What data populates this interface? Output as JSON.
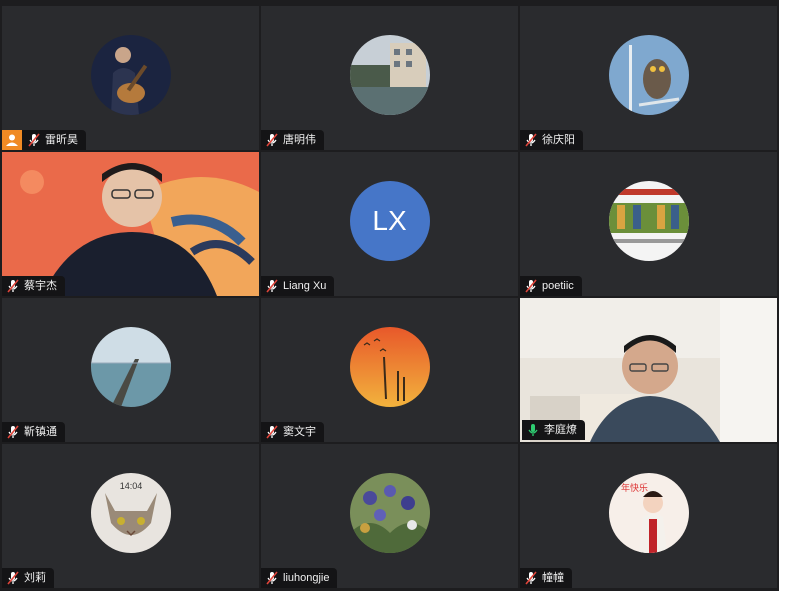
{
  "participants": [
    {
      "name": "雷昕昊",
      "host": true,
      "muted": true,
      "avatar_icon": "guitarist-photo"
    },
    {
      "name": "唐明伟",
      "muted": true,
      "avatar_icon": "building-pond-photo"
    },
    {
      "name": "徐庆阳",
      "muted": true,
      "avatar_icon": "owl-photo"
    },
    {
      "name": "蔡宇杰",
      "muted": true,
      "avatar_icon": "man-video"
    },
    {
      "name": "Liang Xu",
      "muted": true,
      "initials": "LX",
      "avatar_color": "#4676c8"
    },
    {
      "name": "poetiic",
      "muted": true,
      "avatar_icon": "poster-photo"
    },
    {
      "name": "靳镇通",
      "muted": true,
      "avatar_icon": "pier-photo"
    },
    {
      "name": "窦文宇",
      "muted": true,
      "avatar_icon": "sunset-birds-photo"
    },
    {
      "name": "李庭燎",
      "muted": false,
      "speaking": true,
      "avatar_icon": "man-video"
    },
    {
      "name": "刘莉",
      "muted": true,
      "avatar_icon": "cat-photo",
      "avatar_text": "14:04"
    },
    {
      "name": "liuhongjie",
      "muted": true,
      "avatar_icon": "irises-painting"
    },
    {
      "name": "幢幢",
      "muted": true,
      "avatar_icon": "child-photo",
      "avatar_text": "年快乐"
    }
  ],
  "colors": {
    "speaking_border": "#1fbf5c",
    "host_badge": "#f08a24",
    "muted_icon": "#ffffff",
    "active_mic": "#2ecc71"
  }
}
